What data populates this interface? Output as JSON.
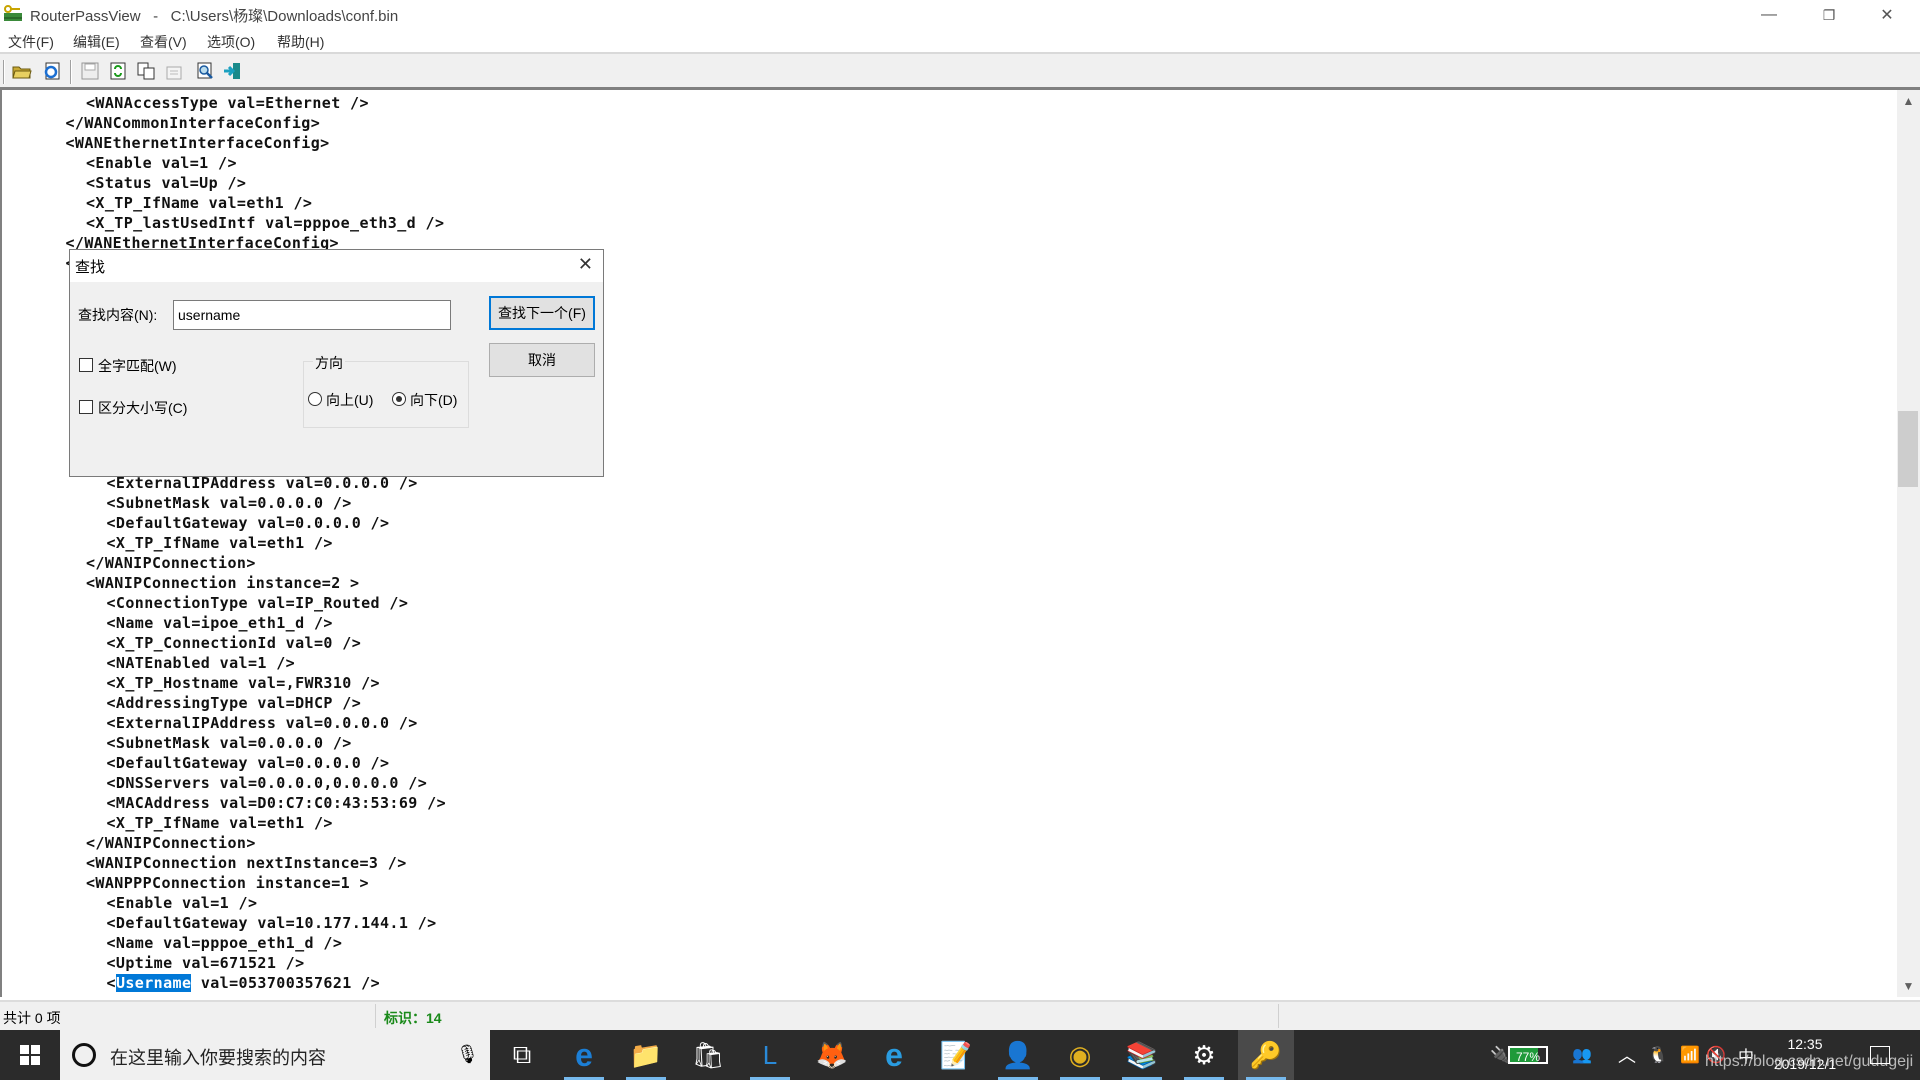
{
  "window": {
    "app_name": "RouterPassView",
    "title": "RouterPassView   -   C:\\Users\\杨璨\\Downloads\\conf.bin",
    "controls": {
      "minimize": "—",
      "restore": "❐",
      "close": "✕"
    }
  },
  "menu": {
    "items": [
      {
        "label": "文件(F)"
      },
      {
        "label": "编辑(E)"
      },
      {
        "label": "查看(V)"
      },
      {
        "label": "选项(O)"
      },
      {
        "label": "帮助(H)"
      }
    ]
  },
  "toolbar": {
    "buttons": [
      {
        "icon": "open-folder-icon",
        "glyph": "📂",
        "enabled": true
      },
      {
        "icon": "open-ie-icon",
        "glyph": "🌐",
        "enabled": true
      },
      {
        "icon": "save-icon",
        "glyph": "💾",
        "enabled": false
      },
      {
        "icon": "refresh-icon",
        "glyph": "♻",
        "enabled": true
      },
      {
        "icon": "copy-icon",
        "glyph": "⎘",
        "enabled": true
      },
      {
        "icon": "properties-icon",
        "glyph": "🗎",
        "enabled": false
      },
      {
        "icon": "find-icon",
        "glyph": "🔍",
        "enabled": true
      },
      {
        "icon": "exit-icon",
        "glyph": "➜",
        "enabled": true
      }
    ]
  },
  "content": {
    "lines": [
      {
        "indent": 4,
        "text": "<WANAccessType val=Ethernet />"
      },
      {
        "indent": 3,
        "text": "</WANCommonInterfaceConfig>"
      },
      {
        "indent": 3,
        "text": "<WANEthernetInterfaceConfig>"
      },
      {
        "indent": 4,
        "text": "<Enable val=1 />"
      },
      {
        "indent": 4,
        "text": "<Status val=Up />"
      },
      {
        "indent": 4,
        "text": "<X_TP_IfName val=eth1 />"
      },
      {
        "indent": 4,
        "text": "<X_TP_lastUsedIntf val=pppoe_eth3_d />"
      },
      {
        "indent": 3,
        "text": "</WANEthernetInterfaceConfig>"
      },
      {
        "indent": 3,
        "text": "<"
      },
      {
        "indent": 0,
        "text": ""
      },
      {
        "indent": 0,
        "text": ""
      },
      {
        "indent": 0,
        "text": ""
      },
      {
        "indent": 0,
        "text": ""
      },
      {
        "indent": 0,
        "text": ""
      },
      {
        "indent": 0,
        "text": ""
      },
      {
        "indent": 0,
        "text": ""
      },
      {
        "indent": 0,
        "text": ""
      },
      {
        "indent": 0,
        "text": ""
      },
      {
        "indent": 0,
        "text": ""
      },
      {
        "indent": 5,
        "text": "<ExternalIPAddress val=0.0.0.0 />"
      },
      {
        "indent": 5,
        "text": "<SubnetMask val=0.0.0.0 />"
      },
      {
        "indent": 5,
        "text": "<DefaultGateway val=0.0.0.0 />"
      },
      {
        "indent": 5,
        "text": "<X_TP_IfName val=eth1 />"
      },
      {
        "indent": 4,
        "text": "</WANIPConnection>"
      },
      {
        "indent": 4,
        "text": "<WANIPConnection instance=2 >"
      },
      {
        "indent": 5,
        "text": "<ConnectionType val=IP_Routed />"
      },
      {
        "indent": 5,
        "text": "<Name val=ipoe_eth1_d />"
      },
      {
        "indent": 5,
        "text": "<X_TP_ConnectionId val=0 />"
      },
      {
        "indent": 5,
        "text": "<NATEnabled val=1 />"
      },
      {
        "indent": 5,
        "text": "<X_TP_Hostname val=,FWR310 />"
      },
      {
        "indent": 5,
        "text": "<AddressingType val=DHCP />"
      },
      {
        "indent": 5,
        "text": "<ExternalIPAddress val=0.0.0.0 />"
      },
      {
        "indent": 5,
        "text": "<SubnetMask val=0.0.0.0 />"
      },
      {
        "indent": 5,
        "text": "<DefaultGateway val=0.0.0.0 />"
      },
      {
        "indent": 5,
        "text": "<DNSServers val=0.0.0.0,0.0.0.0 />"
      },
      {
        "indent": 5,
        "text": "<MACAddress val=D0:C7:C0:43:53:69 />"
      },
      {
        "indent": 5,
        "text": "<X_TP_IfName val=eth1 />"
      },
      {
        "indent": 4,
        "text": "</WANIPConnection>"
      },
      {
        "indent": 4,
        "text": "<WANIPConnection nextInstance=3 />"
      },
      {
        "indent": 4,
        "text": "<WANPPPConnection instance=1 >"
      },
      {
        "indent": 5,
        "text": "<Enable val=1 />"
      },
      {
        "indent": 5,
        "text": "<DefaultGateway val=10.177.144.1 />"
      },
      {
        "indent": 5,
        "text": "<Name val=pppoe_eth1_d />"
      },
      {
        "indent": 5,
        "text": "<Uptime val=671521 />"
      }
    ],
    "highlight_line": {
      "indent": 5,
      "before": "<",
      "match": "Username",
      "after": " val=053700357621 />"
    },
    "scroll_position": 0.38
  },
  "find_dialog": {
    "title": "查找",
    "find_label": "查找内容(N):",
    "find_value": "username",
    "find_next_label": "查找下一个(F)",
    "cancel_label": "取消",
    "match_whole_word_label": "全字匹配(W)",
    "match_whole_word_checked": false,
    "match_case_label": "区分大小写(C)",
    "match_case_checked": false,
    "direction_label": "方向",
    "up_label": "向上(U)",
    "down_label": "向下(D)",
    "direction_selected": "down"
  },
  "statusbar": {
    "count_text": "共计 0 项",
    "marker_label": "标识：",
    "marker_value": "14",
    "marker_color": "#1a8a1a"
  },
  "taskbar": {
    "search_placeholder": "在这里输入你要搜索的内容",
    "apps": [
      {
        "name": "task-view",
        "glyph": "⧉"
      },
      {
        "name": "edge",
        "glyph": "e"
      },
      {
        "name": "file-explorer",
        "glyph": "📁"
      },
      {
        "name": "store",
        "glyph": "🛍"
      },
      {
        "name": "clock-app",
        "glyph": "L"
      },
      {
        "name": "firefox",
        "glyph": "🦊"
      },
      {
        "name": "internet-explorer",
        "glyph": "e"
      },
      {
        "name": "notepad",
        "glyph": "📝"
      },
      {
        "name": "avatar-app",
        "glyph": "👤"
      },
      {
        "name": "chrome",
        "glyph": "◉"
      },
      {
        "name": "winrar",
        "glyph": "📚"
      },
      {
        "name": "settings",
        "glyph": "⚙"
      },
      {
        "name": "routerpassview",
        "glyph": "🔑"
      }
    ],
    "battery_percent": "77%",
    "time": "12:35",
    "date": "2019/12/1",
    "ime": "中",
    "watermark": "https://blog.csdn.net/gudugeji"
  }
}
